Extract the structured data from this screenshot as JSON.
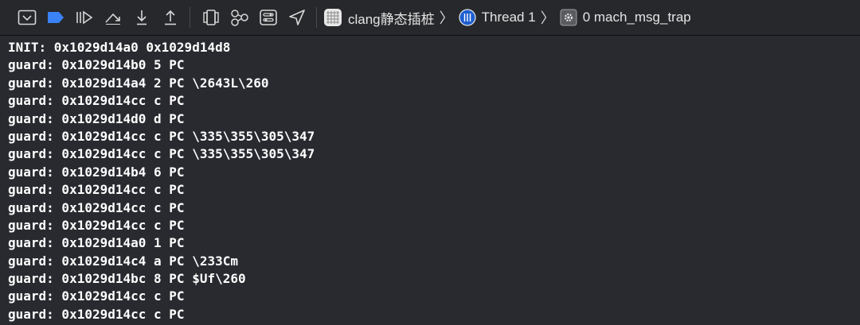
{
  "toolbar": {
    "buttons": [
      {
        "icon": "hide-console-icon"
      },
      {
        "icon": "breakpoint-icon",
        "color": "#3a82f6"
      },
      {
        "icon": "continue-icon"
      },
      {
        "icon": "step-over-icon"
      },
      {
        "icon": "step-into-icon"
      },
      {
        "icon": "step-out-icon"
      },
      {
        "icon": "view-debugger-icon"
      },
      {
        "icon": "memory-graph-icon"
      },
      {
        "icon": "environment-overrides-icon"
      },
      {
        "icon": "simulate-location-icon"
      }
    ],
    "breadcrumb": {
      "target": "clang静态插桩",
      "thread": "Thread 1",
      "frame": "0 mach_msg_trap"
    }
  },
  "console": {
    "lines": [
      "INIT: 0x1029d14a0 0x1029d14d8",
      "guard: 0x1029d14b0 5 PC",
      "guard: 0x1029d14a4 2 PC \\2643L\\260",
      "guard: 0x1029d14cc c PC",
      "guard: 0x1029d14d0 d PC",
      "guard: 0x1029d14cc c PC \\335\\355\\305\\347",
      "guard: 0x1029d14cc c PC \\335\\355\\305\\347",
      "guard: 0x1029d14b4 6 PC",
      "guard: 0x1029d14cc c PC",
      "guard: 0x1029d14cc c PC",
      "guard: 0x1029d14cc c PC",
      "guard: 0x1029d14a0 1 PC",
      "guard: 0x1029d14c4 a PC \\233Cm",
      "guard: 0x1029d14bc 8 PC $Uf\\260",
      "guard: 0x1029d14cc c PC",
      "guard: 0x1029d14cc c PC"
    ],
    "text_color": "#ffffff",
    "background": "#292a30"
  }
}
